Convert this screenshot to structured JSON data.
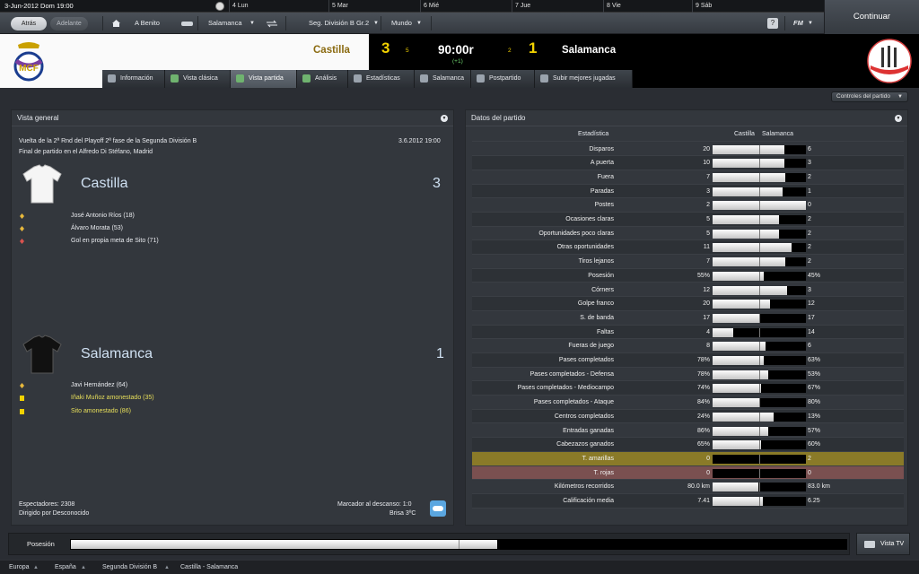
{
  "topbar": {
    "date": "3-Jun-2012  Dom  19:00",
    "days": [
      {
        "label": "4  Lun"
      },
      {
        "label": "5  Mar"
      },
      {
        "label": "6  Mié"
      },
      {
        "label": "7  Jue"
      },
      {
        "label": "8  Vie"
      },
      {
        "label": "9  Sáb"
      }
    ]
  },
  "nav": {
    "back": "Atrás",
    "forward": "Adelante",
    "manager": "A Benito",
    "club": "Salamanca",
    "competition": "Seg. División B Gr.2",
    "world": "Mundo",
    "help": "?",
    "fm": "FM",
    "continue": "Continuar"
  },
  "score": {
    "home": "Castilla",
    "home_goals": "3",
    "home_shots_on": "5",
    "time": "90:00r",
    "added": "(+1)",
    "away_shots_on": "2",
    "away_goals": "1",
    "away": "Salamanca"
  },
  "tabs": [
    {
      "label": "Información"
    },
    {
      "label": "Vista clásica"
    },
    {
      "label": "Vista partida"
    },
    {
      "label": "Análisis"
    },
    {
      "label": "Estadísticas"
    },
    {
      "label": "Salamanca"
    },
    {
      "label": "Postpartido"
    },
    {
      "label": "Subir mejores jugadas"
    }
  ],
  "controls": "Controles del partido",
  "overview": {
    "title": "Vista general",
    "description": "Vuelta de la 2ª Rnd del Playoff 2ª fase de la Segunda División B",
    "venue": "Final de partido en el Alfredo Di Stéfano, Madrid",
    "datetime": "3.6.2012 19:00",
    "home": {
      "name": "Castilla",
      "score": "3",
      "events": [
        {
          "text": "José Antonio Ríos (18)",
          "type": "goal"
        },
        {
          "text": "Álvaro Morata (53)",
          "type": "goal"
        },
        {
          "text": "Gol en propia meta de Sito (71)",
          "type": "own-goal"
        }
      ]
    },
    "away": {
      "name": "Salamanca",
      "score": "1",
      "events": [
        {
          "text": "Javi Hernández (64)",
          "type": "goal"
        },
        {
          "text": "Iñaki Muñoz amonestado (35)",
          "type": "yellow"
        },
        {
          "text": "Sito amonestado (86)",
          "type": "yellow"
        }
      ]
    },
    "attendance": "Espectadores: 2308",
    "referee": "Dirigido por Desconocido",
    "halftime": "Marcador al descanso: 1:0",
    "weather": "Brisa 3ºC"
  },
  "stats": {
    "title": "Datos del partido",
    "header_stat": "Estadística",
    "header_home": "Castilla",
    "header_away": "Salamanca",
    "rows": [
      {
        "label": "Disparos",
        "home": "20",
        "away": "6",
        "share": 0.77
      },
      {
        "label": "A puerta",
        "home": "10",
        "away": "3",
        "share": 0.77
      },
      {
        "label": "Fuera",
        "home": "7",
        "away": "2",
        "share": 0.78
      },
      {
        "label": "Paradas",
        "home": "3",
        "away": "1",
        "share": 0.75
      },
      {
        "label": "Postes",
        "home": "2",
        "away": "0",
        "share": 1.0
      },
      {
        "label": "Ocasiones claras",
        "home": "5",
        "away": "2",
        "share": 0.71
      },
      {
        "label": "Oportunidades poco claras",
        "home": "5",
        "away": "2",
        "share": 0.71
      },
      {
        "label": "Otras oportunidades",
        "home": "11",
        "away": "2",
        "share": 0.85
      },
      {
        "label": "Tiros lejanos",
        "home": "7",
        "away": "2",
        "share": 0.78
      },
      {
        "label": "Posesión",
        "home": "55%",
        "away": "45%",
        "share": 0.55
      },
      {
        "label": "Córners",
        "home": "12",
        "away": "3",
        "share": 0.8
      },
      {
        "label": "Golpe franco",
        "home": "20",
        "away": "12",
        "share": 0.62
      },
      {
        "label": "S. de banda",
        "home": "17",
        "away": "17",
        "share": 0.5
      },
      {
        "label": "Faltas",
        "home": "4",
        "away": "14",
        "share": 0.22
      },
      {
        "label": "Fueras de juego",
        "home": "8",
        "away": "6",
        "share": 0.57
      },
      {
        "label": "Pases completados",
        "home": "78%",
        "away": "63%",
        "share": 0.55
      },
      {
        "label": "Pases completados - Defensa",
        "home": "78%",
        "away": "53%",
        "share": 0.6
      },
      {
        "label": "Pases completados - Mediocampo",
        "home": "74%",
        "away": "67%",
        "share": 0.52
      },
      {
        "label": "Pases completados - Ataque",
        "home": "84%",
        "away": "80%",
        "share": 0.51
      },
      {
        "label": "Centros completados",
        "home": "24%",
        "away": "13%",
        "share": 0.65
      },
      {
        "label": "Entradas ganadas",
        "home": "86%",
        "away": "57%",
        "share": 0.6
      },
      {
        "label": "Cabezazos ganados",
        "home": "65%",
        "away": "60%",
        "share": 0.52
      },
      {
        "label": "T. amarillas",
        "home": "0",
        "away": "2",
        "share": 0.0,
        "highlight": "yellow"
      },
      {
        "label": "T. rojas",
        "home": "0",
        "away": "0",
        "share": 0.0,
        "highlight": "red"
      },
      {
        "label": "Kilómetros recorridos",
        "home": "80.0 km",
        "away": "83.0 km",
        "share": 0.49
      },
      {
        "label": "Calificación media",
        "home": "7.41",
        "away": "6.25",
        "share": 0.54
      }
    ]
  },
  "possession_bar": {
    "label": "Posesión",
    "home_share": 0.55
  },
  "tv_button": "Vista TV",
  "footer": {
    "crumbs": [
      "Europa",
      "España",
      "Segunda División B",
      "Castilla - Salamanca"
    ]
  }
}
